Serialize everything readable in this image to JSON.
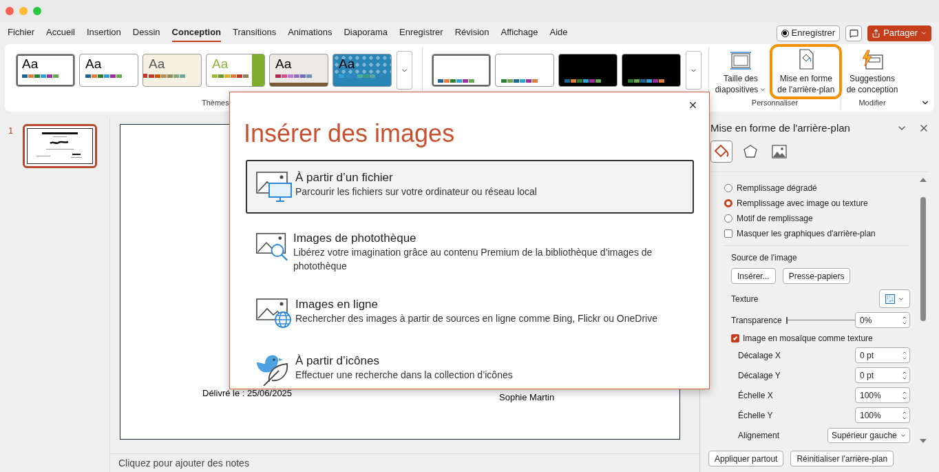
{
  "menu_tabs": [
    {
      "label": "Fichier",
      "selected": false
    },
    {
      "label": "Accueil",
      "selected": false
    },
    {
      "label": "Insertion",
      "selected": false
    },
    {
      "label": "Dessin",
      "selected": false
    },
    {
      "label": "Conception",
      "selected": true
    },
    {
      "label": "Transitions",
      "selected": false
    },
    {
      "label": "Animations",
      "selected": false
    },
    {
      "label": "Diaporama",
      "selected": false
    },
    {
      "label": "Enregistrer",
      "selected": false
    },
    {
      "label": "Révision",
      "selected": false
    },
    {
      "label": "Affichage",
      "selected": false
    },
    {
      "label": "Aide",
      "selected": false
    }
  ],
  "title_buttons": [
    {
      "kind": "record",
      "label": "Enregistrer"
    },
    {
      "kind": "comment"
    },
    {
      "kind": "share",
      "label": "Partager"
    }
  ],
  "ribbon": {
    "themes": {
      "label": "Thèmes",
      "items": [
        {
          "label": "Aa",
          "kind": "plain",
          "selected": true,
          "swatches": [
            {
              "color": "#1f6391"
            },
            {
              "color": "#e07b39"
            },
            {
              "color": "#2e7d32"
            },
            {
              "color": "#2ea3d8"
            },
            {
              "color": "#9c2f9c"
            },
            {
              "color": "#6aa84f"
            }
          ]
        },
        {
          "label": "Aa",
          "kind": "plain",
          "selected": false,
          "swatches": [
            {
              "color": "#1f6391"
            },
            {
              "color": "#e07b39"
            },
            {
              "color": "#2e7d32"
            },
            {
              "color": "#2ea3d8"
            },
            {
              "color": "#9c2f9c"
            },
            {
              "color": "#6aa84f"
            }
          ]
        },
        {
          "label": "Aa",
          "kind": "cream",
          "selected": false,
          "swatches": [
            {
              "color": "#c0392b"
            },
            {
              "color": "#d35400"
            },
            {
              "color": "#b58f5a"
            },
            {
              "color": "#8e8e5a"
            },
            {
              "color": "#8aa67a"
            },
            {
              "color": "#6fa89a"
            }
          ]
        },
        {
          "label": "Aa",
          "kind": "green",
          "selected": false,
          "swatches": [
            {
              "color": "#9bbb3a"
            },
            {
              "color": "#6a9a2a"
            },
            {
              "color": "#e1b12c"
            },
            {
              "color": "#e07b39"
            },
            {
              "color": "#c0392b"
            },
            {
              "color": "#8e7f5a"
            }
          ]
        },
        {
          "label": "Aa",
          "kind": "wood",
          "selected": false,
          "swatches": [
            {
              "color": "#b2294f"
            },
            {
              "color": "#d94d8c"
            },
            {
              "color": "#b77bd6"
            },
            {
              "color": "#8e6fc0"
            },
            {
              "color": "#6d70b8"
            },
            {
              "color": "#6b8fb5"
            }
          ]
        },
        {
          "label": "Aa",
          "kind": "pattern",
          "selected": false,
          "swatches": [
            {
              "color": "#2ea3d8"
            },
            {
              "color": "#2b8fc7"
            },
            {
              "color": "#3a7fc0"
            },
            {
              "color": "#47b39c"
            },
            {
              "color": "#3e9a7a"
            },
            {
              "color": "#5aa59a"
            }
          ]
        }
      ]
    },
    "variants": {
      "items": [
        {
          "dark": false,
          "selected": true,
          "swatches": [
            {
              "color": "#1f6391"
            },
            {
              "color": "#e07b39"
            },
            {
              "color": "#2e7d32"
            },
            {
              "color": "#2ea3d8"
            },
            {
              "color": "#9c2f9c"
            },
            {
              "color": "#6aa84f"
            }
          ]
        },
        {
          "dark": false,
          "selected": false,
          "swatches": [
            {
              "color": "#2e7d32"
            },
            {
              "color": "#6aa84f"
            },
            {
              "color": "#1f6391"
            },
            {
              "color": "#2ea3d8"
            },
            {
              "color": "#9c2f9c"
            },
            {
              "color": "#e07b39"
            }
          ]
        },
        {
          "dark": true,
          "selected": false,
          "swatches": [
            {
              "color": "#1f6391"
            },
            {
              "color": "#e07b39"
            },
            {
              "color": "#2e7d32"
            },
            {
              "color": "#2ea3d8"
            },
            {
              "color": "#9c2f9c"
            },
            {
              "color": "#6aa84f"
            }
          ]
        },
        {
          "dark": true,
          "selected": false,
          "swatches": [
            {
              "color": "#2e7d32"
            },
            {
              "color": "#6aa84f"
            },
            {
              "color": "#1f6391"
            },
            {
              "color": "#2ea3d8"
            },
            {
              "color": "#9c2f9c"
            },
            {
              "color": "#e07b39"
            }
          ]
        }
      ]
    },
    "customize": {
      "label": "Personnaliser",
      "buttons": [
        {
          "kind": "slide-size",
          "lines": [
            "Taille des",
            "diapositives"
          ],
          "dropdown": true,
          "highlighted": false
        },
        {
          "kind": "format-background",
          "lines": [
            "Mise en forme",
            "de l'arrière-plan"
          ],
          "dropdown": false,
          "highlighted": true
        }
      ]
    },
    "modify": {
      "label": "Modifier",
      "buttons": [
        {
          "kind": "designer",
          "lines": [
            "Suggestions",
            "de conception"
          ],
          "dropdown": false,
          "highlighted": false
        }
      ]
    }
  },
  "slides": [
    {
      "number": "1",
      "selected": true
    }
  ],
  "slide": {
    "texts": [
      {
        "text": "Délivré le : 25/06/2025",
        "kind": "date"
      },
      {
        "text": "Sophie Martin",
        "kind": "signer"
      }
    ]
  },
  "notes": {
    "placeholder": "Cliquez pour ajouter des notes"
  },
  "format_pane": {
    "title": "Mise en forme de l'arrière-plan",
    "tabs": [
      {
        "kind": "fill",
        "selected": true
      },
      {
        "kind": "effects",
        "selected": false
      },
      {
        "kind": "picture",
        "selected": false
      }
    ],
    "fill_options": [
      {
        "kind": "radio",
        "label": "Remplissage dégradé",
        "checked": false
      },
      {
        "kind": "radio",
        "label": "Remplissage avec image ou texture",
        "checked": true
      },
      {
        "kind": "radio",
        "label": "Motif de remplissage",
        "checked": false
      },
      {
        "kind": "checkbox",
        "label": "Masquer les graphiques d'arrière-plan",
        "checked": false
      }
    ],
    "source": {
      "label": "Source de l'image",
      "buttons": [
        "Insérer...",
        "Presse-papiers"
      ]
    },
    "texture": {
      "label": "Texture"
    },
    "transparency": {
      "label": "Transparence",
      "level": 0,
      "value": "0%"
    },
    "tile": {
      "label": "Image en mosaïque comme texture",
      "checked": true
    },
    "tile_settings": [
      {
        "label": "Décalage X",
        "value": "0 pt"
      },
      {
        "label": "Décalage Y",
        "value": "0 pt"
      },
      {
        "label": "Échelle X",
        "value": "100%"
      },
      {
        "label": "Échelle Y",
        "value": "100%"
      }
    ],
    "alignment": {
      "label": "Alignement",
      "value": "Supérieur gauche"
    },
    "footer_buttons": [
      "Appliquer partout",
      "Réinitialiser l'arrière-plan"
    ]
  },
  "dialog": {
    "title": "Insérer des images",
    "options": [
      {
        "kind": "file",
        "title": "À partir d’un fichier",
        "description": "Parcourir les fichiers sur votre ordinateur ou réseau local",
        "selected": true
      },
      {
        "kind": "stock",
        "title": "Images de photothèque",
        "description": "Libérez votre imagination grâce au contenu Premium de la bibliothèque d’images de photothèque",
        "selected": false
      },
      {
        "kind": "online",
        "title": "Images en ligne",
        "description": "Rechercher des images à partir de sources en ligne comme Bing, Flickr ou OneDrive",
        "selected": false
      },
      {
        "kind": "icons",
        "title": "À partir d’icônes",
        "description": "Effectuer une recherche dans la collection d’icônes",
        "selected": false
      }
    ]
  }
}
